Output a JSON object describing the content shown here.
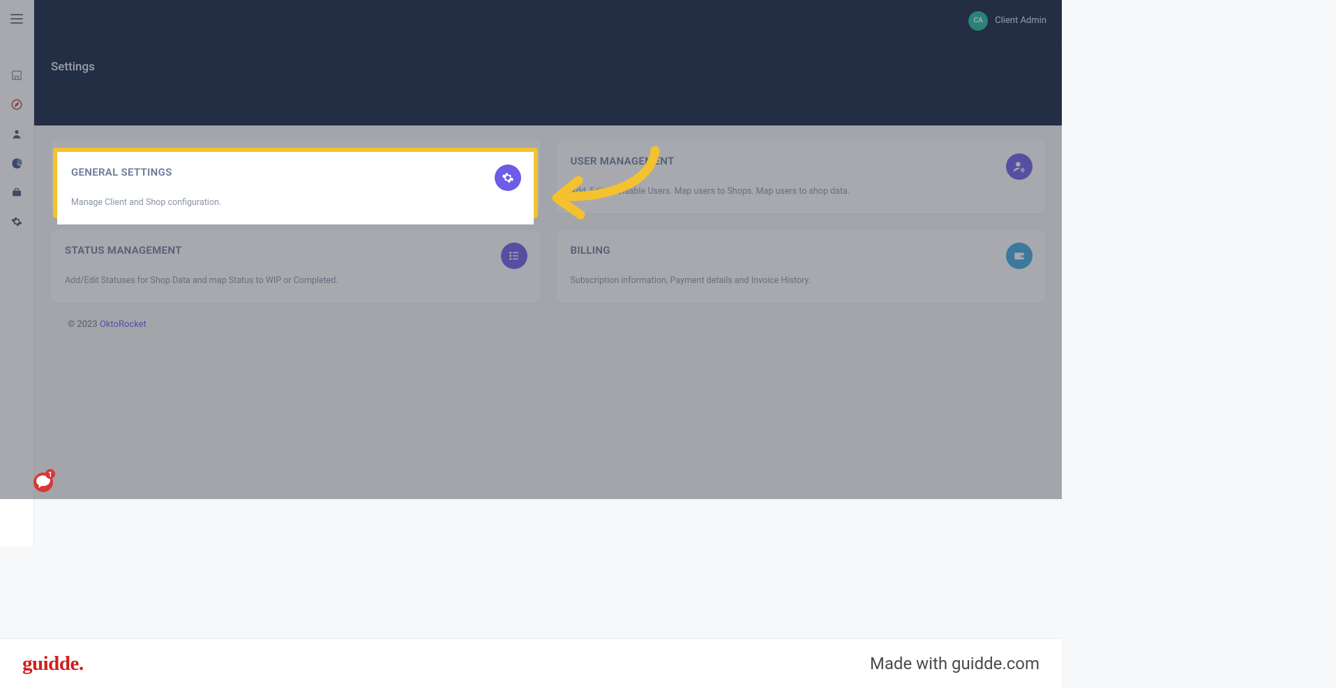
{
  "header": {
    "page_title": "Settings"
  },
  "user": {
    "initials": "CA",
    "name": "Client Admin"
  },
  "cards": {
    "general": {
      "title": "GENERAL SETTINGS",
      "desc": "Manage Client and Shop configuration."
    },
    "user_mgmt": {
      "title": "USER MANAGEMENT",
      "desc": "Add, Edit or Disable Users. Map users to Shops. Map users to shop data."
    },
    "status_mgmt": {
      "title": "STATUS MANAGEMENT",
      "desc": "Add/Edit Statuses for Shop Data and map Status to WIP or Completed."
    },
    "billing": {
      "title": "BILLING",
      "desc": "Subscription information, Payment details and Invoice History."
    }
  },
  "footer": {
    "copyright": "© 2023 ",
    "brand": "OktoRocket"
  },
  "banner": {
    "logo_text": "guidde.",
    "made_with": "Made with guidde.com"
  },
  "chat": {
    "badge": "1"
  }
}
